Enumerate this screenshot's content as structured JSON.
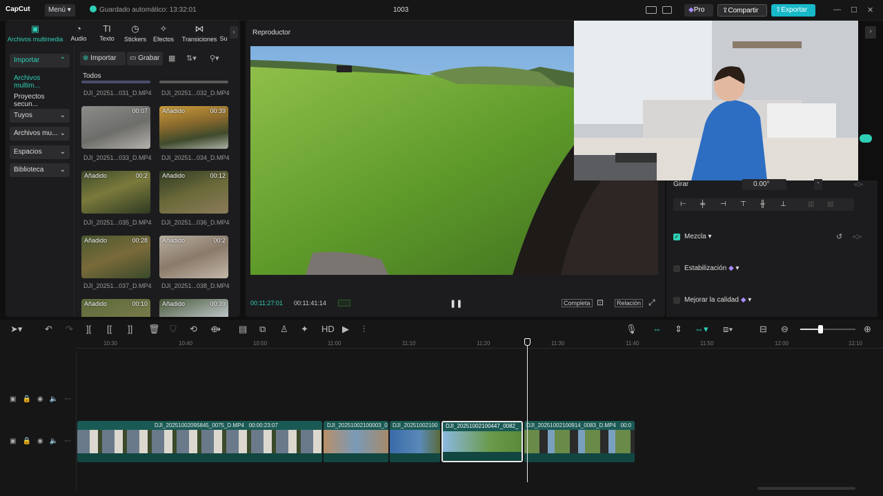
{
  "app": {
    "logo": "CapCut",
    "menu": "Menú",
    "autosave": "Guardado automático: 13:32:01",
    "title": "1003",
    "pro": "Pro",
    "share": "Compartir",
    "export": "Exportar",
    "accent": "#2ecfb5"
  },
  "media_tabs": [
    {
      "label": "Archivos multimedia",
      "icon": "media-icon"
    },
    {
      "label": "Audio",
      "icon": "audio-icon"
    },
    {
      "label": "Texto",
      "icon": "text-icon"
    },
    {
      "label": "Stickers",
      "icon": "sticker-icon"
    },
    {
      "label": "Efectos",
      "icon": "effects-icon"
    },
    {
      "label": "Transiciones",
      "icon": "transitions-icon"
    },
    {
      "label": "Su",
      "icon": "subtitles-icon"
    }
  ],
  "sidebar": {
    "items": [
      {
        "label": "Importar"
      },
      {
        "label": "Archivos multim..."
      },
      {
        "label": "Proyectos secun..."
      },
      {
        "label": "Tuyos"
      },
      {
        "label": "Archivos mu..."
      },
      {
        "label": "Espacios"
      },
      {
        "label": "Biblioteca"
      }
    ]
  },
  "media_toolbar": {
    "import": "Importar",
    "record": "Grabar",
    "filter_all": "Todos"
  },
  "media_items": [
    {
      "name": "DJI_20251...031_D.MP4",
      "tag": "",
      "duration": ""
    },
    {
      "name": "DJI_20251...032_D.MP4",
      "tag": "",
      "duration": ""
    },
    {
      "name": "DJI_20251...033_D.MP4",
      "tag": "",
      "duration": "00:07"
    },
    {
      "name": "DJI_20251...034_D.MP4",
      "tag": "Añadido",
      "duration": "00:39"
    },
    {
      "name": "DJI_20251...035_D.MP4",
      "tag": "Añadido",
      "duration": "00:2"
    },
    {
      "name": "DJI_20251...036_D.MP4",
      "tag": "Añadido",
      "duration": "00:12"
    },
    {
      "name": "DJI_20251...037_D.MP4",
      "tag": "Añadido",
      "duration": "00:28"
    },
    {
      "name": "DJI_20251...038_D.MP4",
      "tag": "Añadido",
      "duration": "00:2"
    },
    {
      "name": "",
      "tag": "Añadido",
      "duration": "00:10"
    },
    {
      "name": "",
      "tag": "Añadido",
      "duration": "00:39"
    }
  ],
  "player": {
    "title": "Reproductor",
    "current_time": "00:11:27:01",
    "total_time": "00:11:41:14",
    "full": "Completa",
    "ratio": "Relación"
  },
  "props": {
    "rotate_label": "Girar",
    "rotate_value": "0.00°",
    "blend": "Mezcla",
    "stabilize": "Estabilización",
    "enhance": "Mejorar la calidad"
  },
  "timeline": {
    "ticks": [
      "10:30",
      "10:40",
      "10:50",
      "11:00",
      "11:10",
      "11:20",
      "11:30",
      "11:40",
      "11:50",
      "12:00",
      "12:10"
    ],
    "clips": [
      {
        "label": "DJI_20251002095845_0075_D.MP4",
        "duration": "00:00:23:07"
      },
      {
        "label": "DJI_20251002100003_0",
        "duration": ""
      },
      {
        "label": "DJI_20251002100",
        "duration": ""
      },
      {
        "label": "DJI_20251002100447_0082_",
        "duration": ""
      },
      {
        "label": "DJI_20251002100914_0083_D.MP4",
        "duration": "00:0"
      }
    ]
  }
}
